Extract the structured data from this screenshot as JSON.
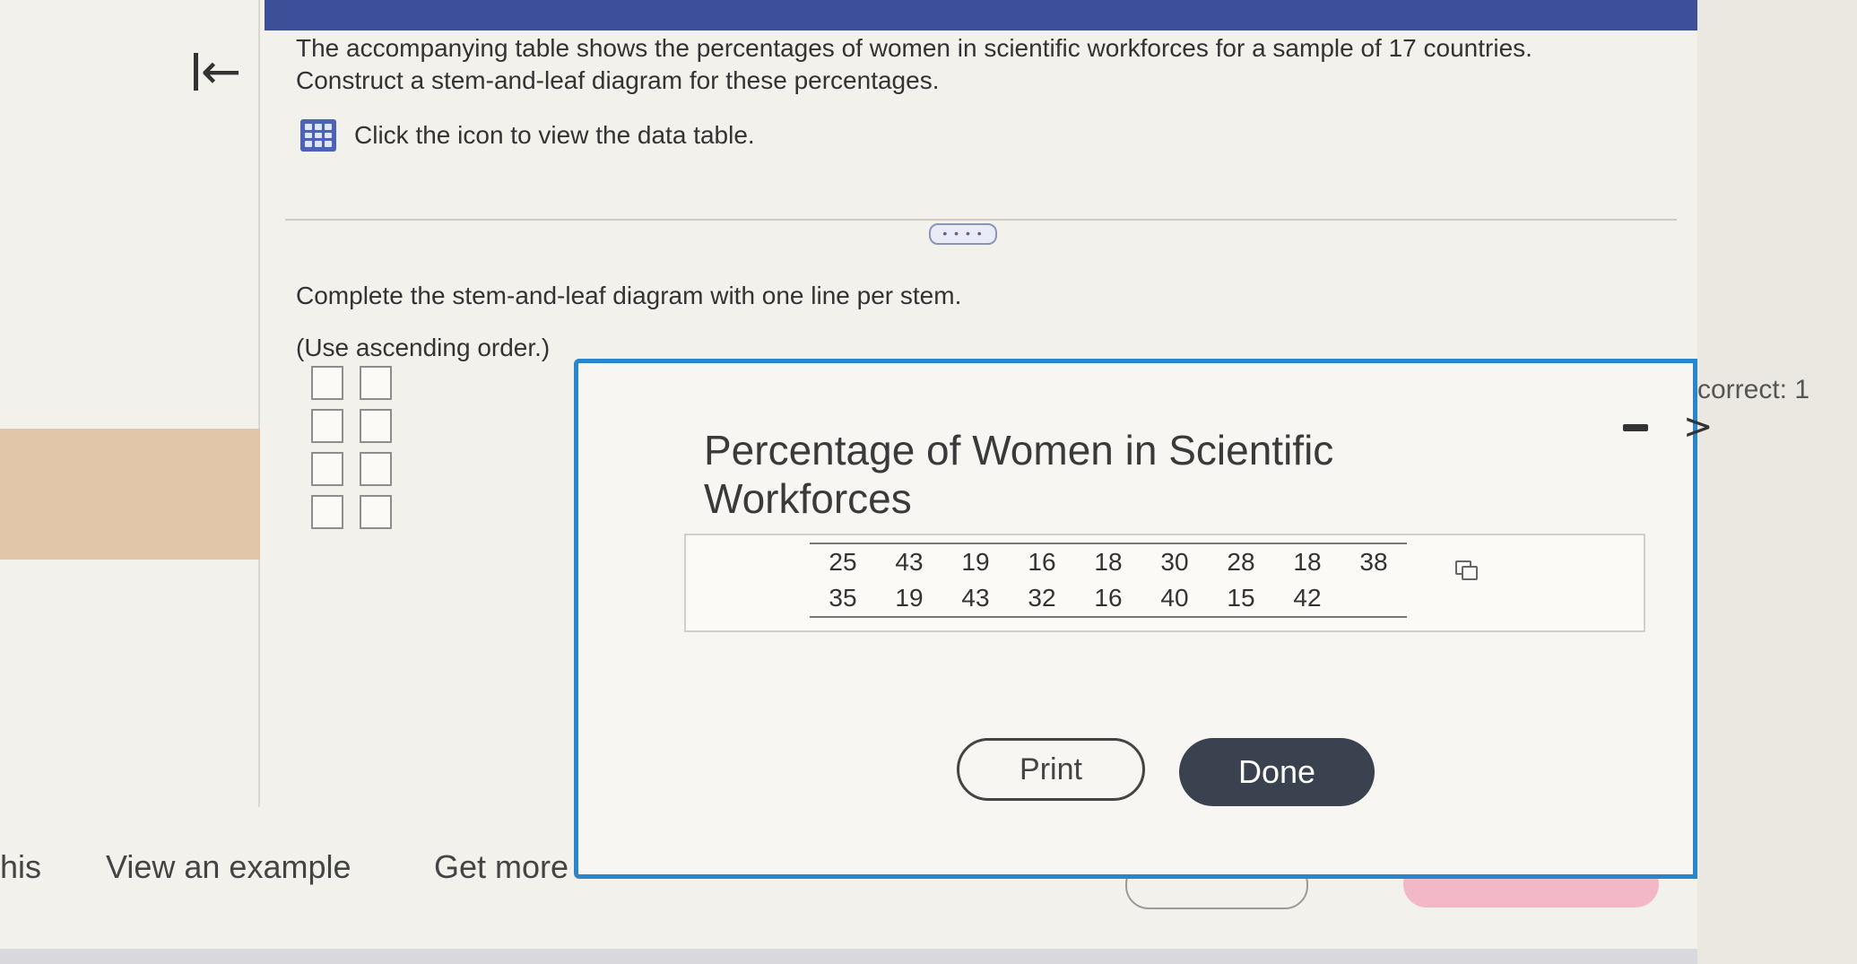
{
  "question": {
    "line1": "The accompanying table shows the percentages of women in scientific workforces for a sample of 17 countries.",
    "line2": "Construct a stem-and-leaf diagram for these percentages.",
    "data_link": "Click the icon to view the data table.",
    "more_indicator": "• • • •",
    "instruction": "Complete the stem-and-leaf diagram with one line per stem.",
    "hint": "(Use ascending order.)"
  },
  "stem_leaf_rows": 4,
  "modal": {
    "title": "Percentage of Women in Scientific Workforces",
    "row1": [
      "25",
      "43",
      "19",
      "16",
      "18",
      "30",
      "28",
      "18",
      "38"
    ],
    "row2": [
      "35",
      "19",
      "43",
      "32",
      "16",
      "40",
      "15",
      "42",
      ""
    ],
    "print_label": "Print",
    "done_label": "Done"
  },
  "bottom": {
    "partial_left": "his",
    "view_example": "View an example",
    "get_more": "Get more"
  },
  "sidebar": {
    "correct_label": "correct: 1"
  },
  "icons": {
    "back": "back-to-start-icon",
    "data_table": "data-table-icon",
    "copy": "copy-icon",
    "minimize": "minimize-icon",
    "next": "chevron-right-icon"
  },
  "colors": {
    "topbar": "#3e4f9a",
    "modal_border": "#2a86cc",
    "done_button": "#3a4250",
    "highlight": "#e2c6a9"
  }
}
